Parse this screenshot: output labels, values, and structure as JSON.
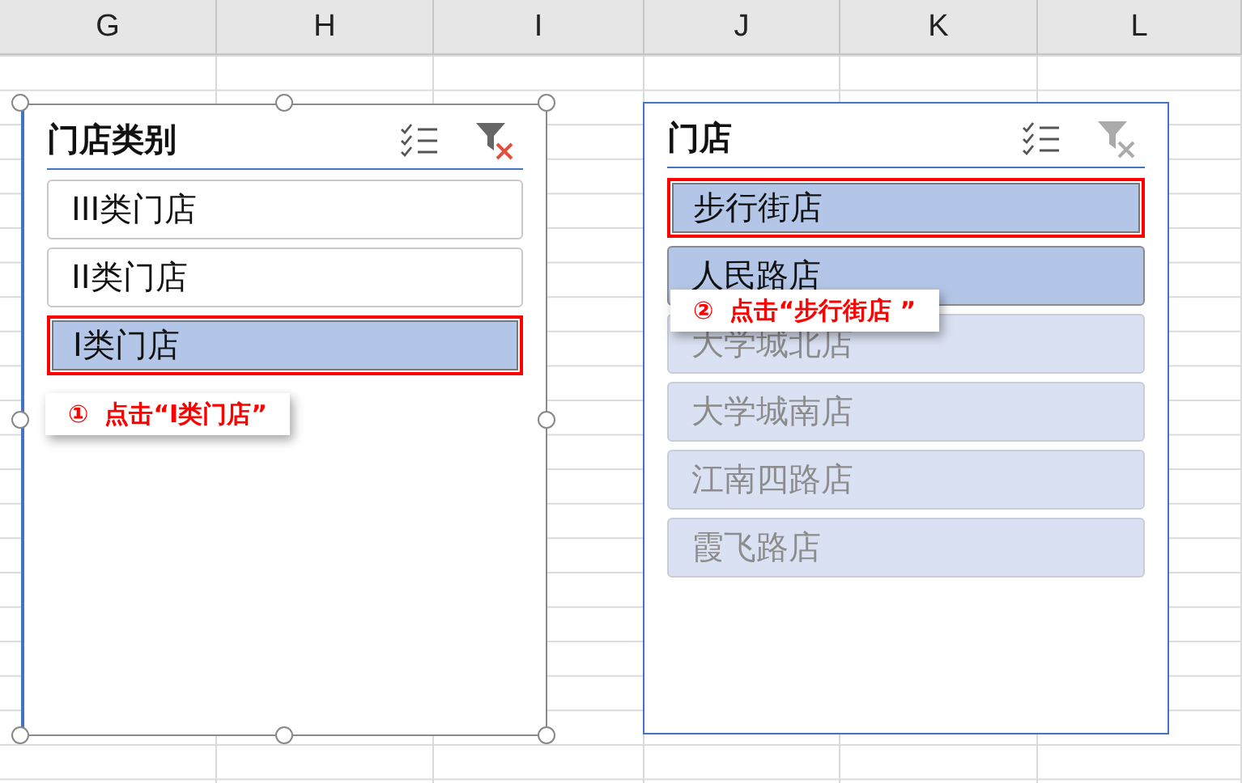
{
  "columns": [
    "G",
    "H",
    "I",
    "J",
    "K",
    "L"
  ],
  "slicers": [
    {
      "title": "门店类别",
      "selected": true,
      "filter_active": true,
      "items": [
        {
          "label": "III类门店",
          "selected": false,
          "has_data": true,
          "highlighted": false
        },
        {
          "label": "II类门店",
          "selected": false,
          "has_data": true,
          "highlighted": false
        },
        {
          "label": "I类门店",
          "selected": true,
          "has_data": true,
          "highlighted": true
        }
      ],
      "callout": {
        "number": "①",
        "text": "点击“I类门店”"
      }
    },
    {
      "title": "门店",
      "selected": false,
      "filter_active": false,
      "items": [
        {
          "label": "步行街店",
          "selected": true,
          "has_data": true,
          "highlighted": true
        },
        {
          "label": "人民路店",
          "selected": true,
          "has_data": true,
          "highlighted": false
        },
        {
          "label": "大学城北店",
          "selected": false,
          "has_data": false,
          "highlighted": false
        },
        {
          "label": "大学城南店",
          "selected": false,
          "has_data": false,
          "highlighted": false
        },
        {
          "label": "江南四路店",
          "selected": false,
          "has_data": false,
          "highlighted": false
        },
        {
          "label": "霞飞路店",
          "selected": false,
          "has_data": false,
          "highlighted": false
        }
      ],
      "callout": {
        "number": "②",
        "text": "点击“步行街店 ”"
      }
    }
  ]
}
